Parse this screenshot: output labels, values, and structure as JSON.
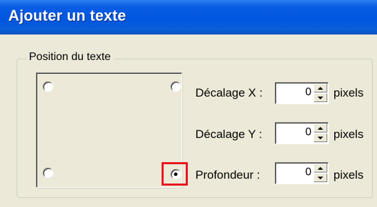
{
  "window": {
    "title": "Ajouter un texte"
  },
  "group": {
    "legend": "Position du texte",
    "selected_position": "bottom-right"
  },
  "fields": [
    {
      "label": "Décalage X :",
      "value": "0",
      "unit": "pixels"
    },
    {
      "label": "Décalage Y :",
      "value": "0",
      "unit": "pixels"
    },
    {
      "label": "Profondeur :",
      "value": "0",
      "unit": "pixels"
    }
  ],
  "colors": {
    "titlebar": "#0056e0",
    "dialog_bg": "#ece9d8",
    "highlight": "#e8141c"
  }
}
